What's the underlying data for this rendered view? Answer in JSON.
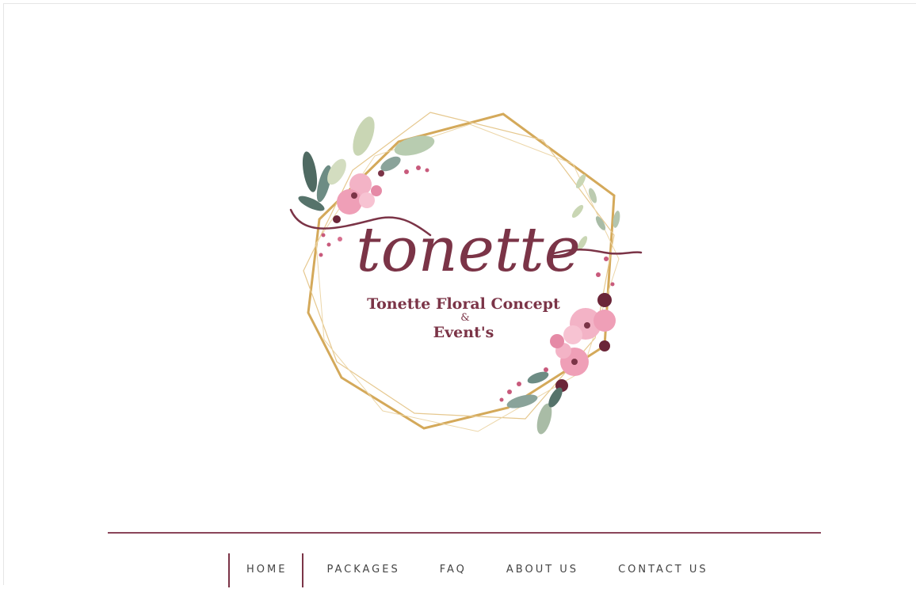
{
  "brand": {
    "script_name": "tonette",
    "line1": "Tonette Floral Concept",
    "line2": "&",
    "line3": "Event's",
    "colors": {
      "burgundy": "#7b3447",
      "gold": "#d4a95a",
      "pink": "#ef9fb7",
      "leaf": "#5f7a72"
    }
  },
  "nav": {
    "items": [
      {
        "label": "HOME",
        "active": true
      },
      {
        "label": "PACKAGES",
        "active": false
      },
      {
        "label": "FAQ",
        "active": false
      },
      {
        "label": "ABOUT US",
        "active": false
      },
      {
        "label": "CONTACT US",
        "active": false
      }
    ]
  }
}
